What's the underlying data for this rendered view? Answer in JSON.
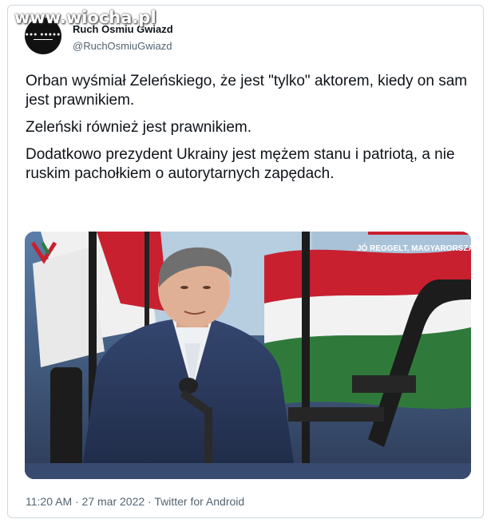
{
  "watermark": "www.wiocha.pl",
  "author": {
    "display_name": "Ruch Osmiu Gwiazd",
    "handle": "@RuchOsmiuGwiazd"
  },
  "tweet": {
    "paragraphs": [
      "Orban wyśmiał Zeleńskiego, że jest \"tylko\" aktorem, kiedy on sam jest prawnikiem.",
      "Zeleński również jest prawnikiem.",
      "Dodatkowo prezydent Ukrainy jest mężem stanu i patriotą, a nie ruskim pachołkiem o autorytarnych zapędach."
    ],
    "meta": "11:20 AM · 27 mar 2022 · Twitter for Android"
  },
  "media": {
    "broadcast_caption": "JÓ REGGELT, MAGYARORSZÁ",
    "colors": {
      "red": "#c8202f",
      "white": "#f2f2f2",
      "green": "#2f7a3a",
      "suit": "#2c3e63",
      "studio": "#3a4a68"
    }
  }
}
